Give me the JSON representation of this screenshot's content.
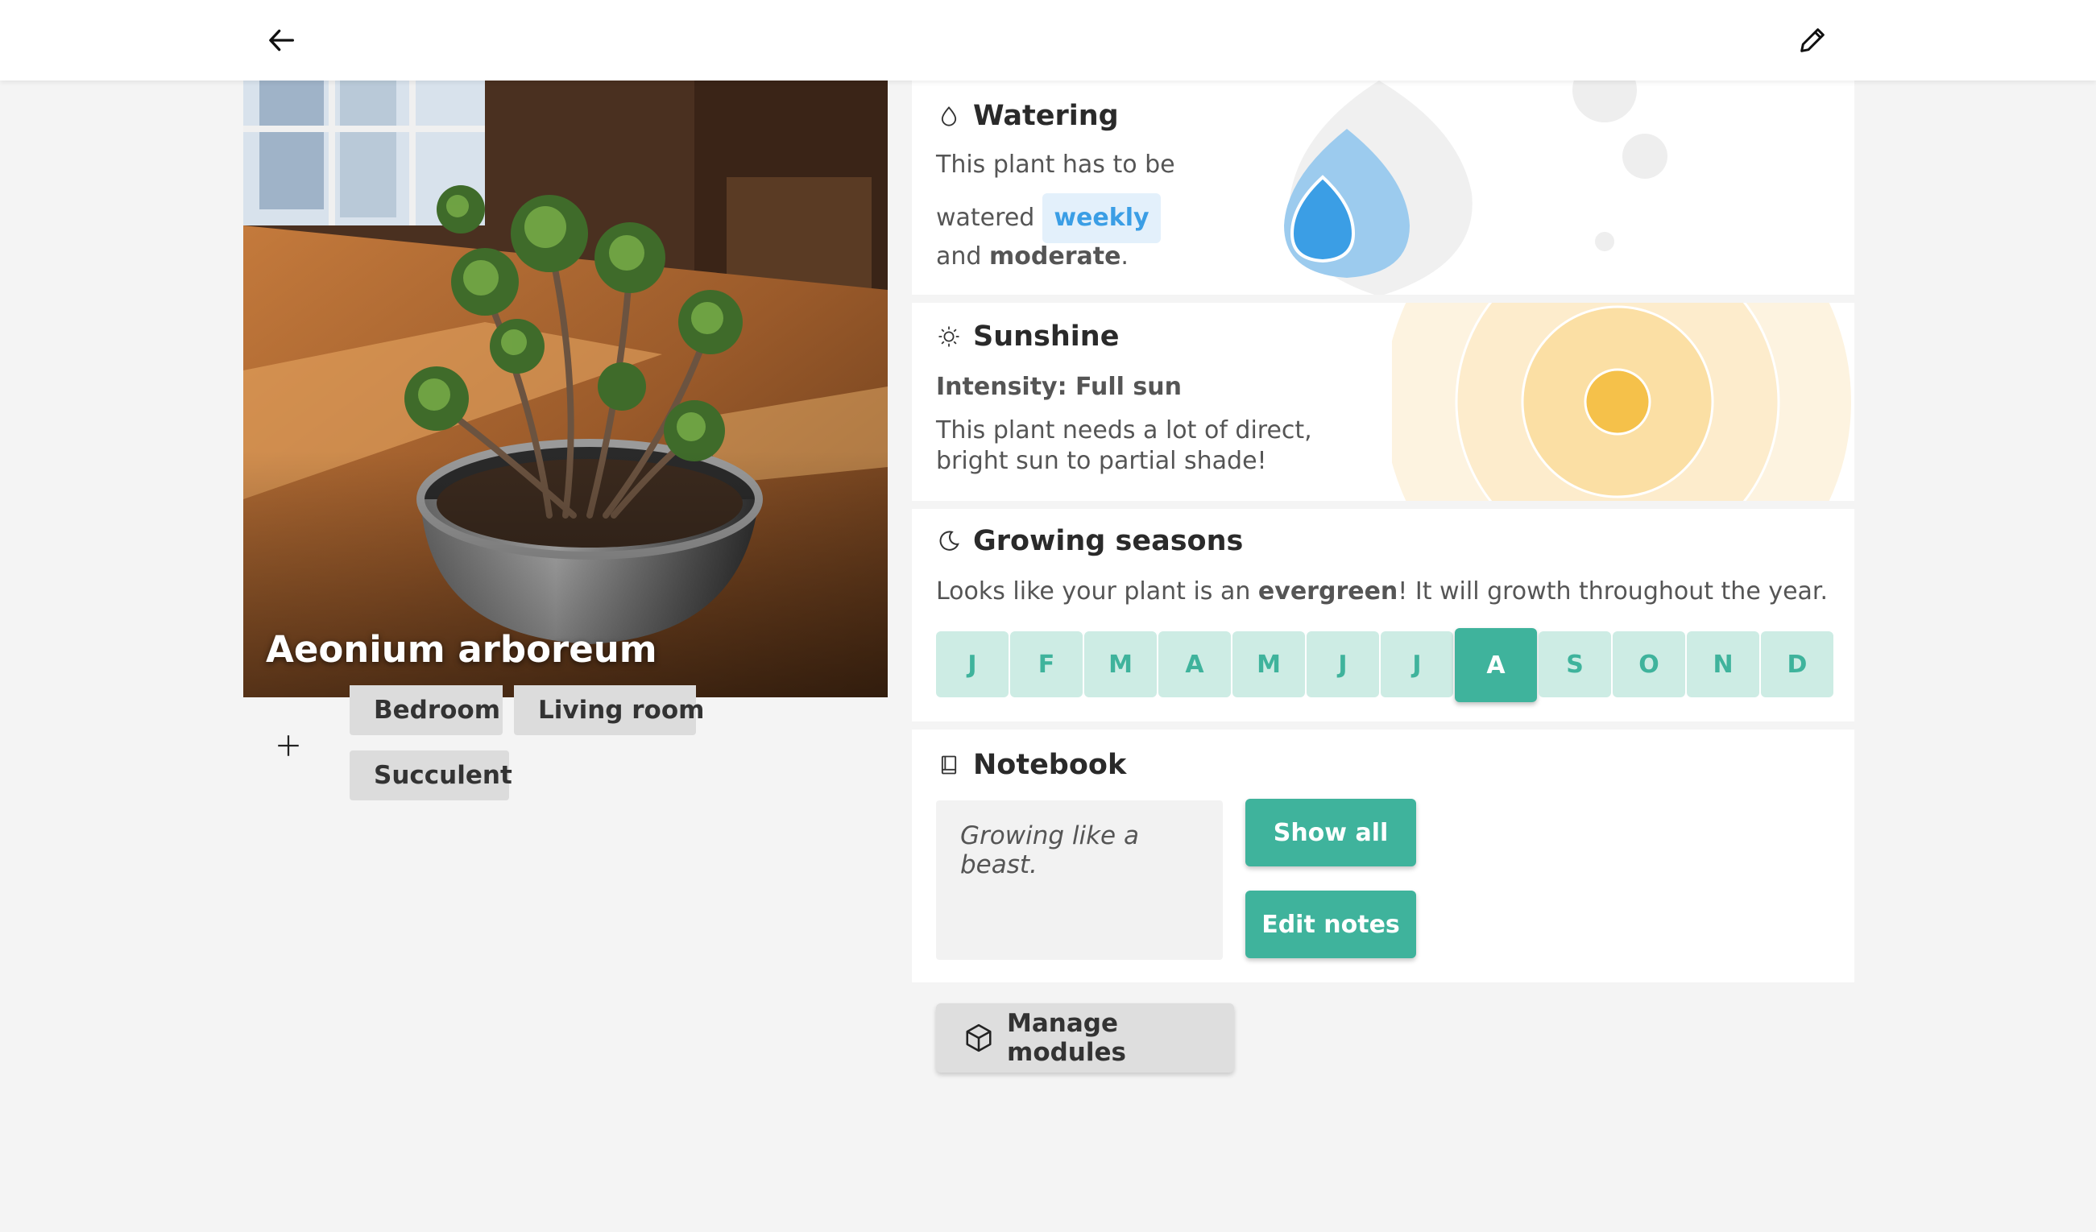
{
  "toolbar": {
    "back_icon": "arrow-left-icon",
    "edit_icon": "pencil-icon"
  },
  "plant": {
    "name": "Aeonium arboreum",
    "photo": "potted-succulent-photo"
  },
  "tags": {
    "add_icon": "plus-icon",
    "items": [
      "Bedroom",
      "Living room",
      "Succulent"
    ]
  },
  "watering": {
    "title": "Watering",
    "icon": "droplet-icon",
    "line1": "This plant has to be",
    "line2_prefix": "watered",
    "frequency": "weekly",
    "line3_prefix": "and",
    "amount": "moderate",
    "line3_suffix": "."
  },
  "sunshine": {
    "title": "Sunshine",
    "icon": "sun-icon",
    "intensity": "Intensity: Full sun",
    "description": "This plant needs a lot of direct, bright sun to partial shade!"
  },
  "seasons": {
    "title": "Growing seasons",
    "icon": "moon-icon",
    "desc_prefix": "Looks like your plant is an",
    "desc_bold": "evergreen",
    "desc_suffix": "! It will growth throughout the year.",
    "months": [
      "J",
      "F",
      "M",
      "A",
      "M",
      "J",
      "J",
      "A",
      "S",
      "O",
      "N",
      "D"
    ],
    "active_index": 7
  },
  "notebook": {
    "title": "Notebook",
    "icon": "book-icon",
    "note": "Growing like a beast.",
    "show_all": "Show all",
    "edit_notes": "Edit notes"
  },
  "manage": {
    "label": "Manage modules",
    "icon": "cube-icon"
  },
  "colors": {
    "accent_teal": "#3fb39c",
    "water_blue": "#3b9ee5",
    "sun_yellow": "#f5c14a",
    "background": "#f4f4f4"
  }
}
